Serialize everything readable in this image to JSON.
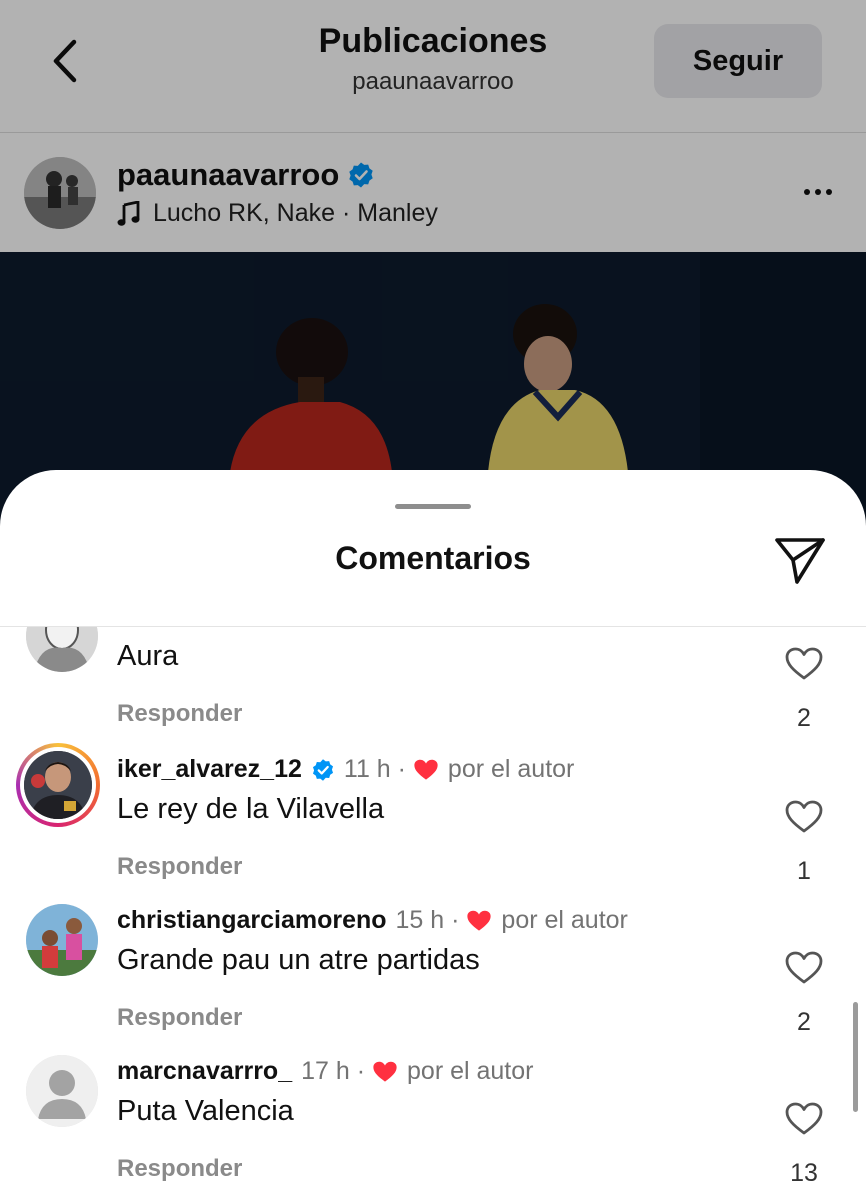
{
  "topbar": {
    "title": "Publicaciones",
    "subtitle": "paaunaavarroo",
    "follow_label": "Seguir"
  },
  "post": {
    "username": "paaunaavarroo",
    "verified": true,
    "music": "Lucho RK, Nake · Manley"
  },
  "sheet": {
    "title": "Comentarios"
  },
  "comments": [
    {
      "username": "",
      "text": "Aura",
      "reply_label": "Responder",
      "likes": "2"
    },
    {
      "username": "iker_alvarez_12",
      "verified": true,
      "time": "11 h",
      "author_like": "por el autor",
      "text": "Le rey de la Vilavella",
      "reply_label": "Responder",
      "likes": "1"
    },
    {
      "username": "christiangarciamoreno",
      "time": "15 h",
      "author_like": "por el autor",
      "text": "Grande pau un atre partidas",
      "reply_label": "Responder",
      "likes": "2"
    },
    {
      "username": "marcnavarrro_",
      "time": "17 h",
      "author_like": "por el autor",
      "text": "Puta Valencia",
      "reply_label": "Responder",
      "likes": "13"
    }
  ],
  "icons": {
    "back": "chevron-left-icon",
    "verified": "verified-badge-icon",
    "music": "music-note-icon",
    "more": "more-horizontal-icon",
    "share": "send-icon",
    "like": "heart-outline-icon",
    "author_heart": "heart-filled-icon"
  },
  "colors": {
    "verified": "#0095f6",
    "author_heart": "#ff3040",
    "secondary_text": "#737373"
  }
}
